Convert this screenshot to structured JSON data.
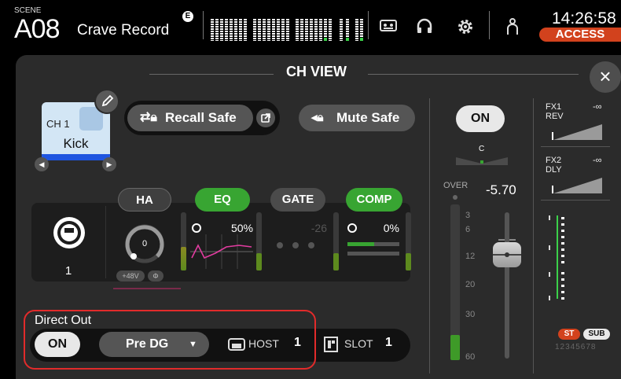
{
  "top": {
    "scene_caption": "SCENE",
    "scene_number": "A08",
    "scene_name": "Crave Record",
    "badge": "E",
    "time": "14:26:58",
    "access": "ACCESS",
    "icons": [
      "tape-recorder-icon",
      "headphones-icon",
      "gear-icon",
      "user-icon"
    ]
  },
  "panel": {
    "title": "CH VIEW",
    "close": "×"
  },
  "channel": {
    "number": "CH 1",
    "name": "Kick",
    "color": "#1f55e0",
    "prev": "◀",
    "next": "▶"
  },
  "safe": {
    "recall_safe": "Recall Safe",
    "mute_safe": "Mute Safe"
  },
  "tabs": {
    "ha": "HA",
    "eq": "EQ",
    "gate": "GATE",
    "comp": "COMP"
  },
  "input": {
    "number": "1"
  },
  "ha": {
    "gain": "0",
    "phantom": "+48V",
    "phase": "Φ"
  },
  "eq": {
    "value": "50%"
  },
  "gate": {
    "value": "-26"
  },
  "comp": {
    "value": "0%"
  },
  "direct_out": {
    "label": "Direct Out",
    "on": "ON",
    "point": "Pre DG",
    "host_label": "HOST",
    "host_value": "1",
    "slot_label": "SLOT",
    "slot_value": "1"
  },
  "fader": {
    "on": "ON",
    "pan": "C",
    "level": "-5.70",
    "over": "OVER",
    "scale": [
      "3",
      "6",
      "12",
      "20",
      "30",
      "60"
    ]
  },
  "sends": {
    "fx1_name": "FX1",
    "fx1_type": "REV",
    "fx1_level": "-∞",
    "fx2_name": "FX2",
    "fx2_type": "DLY",
    "fx2_level": "-∞",
    "st": "ST",
    "sub": "SUB",
    "dca_numbers": "12345678"
  },
  "colors": {
    "green": "#38a532",
    "access": "#d2421d",
    "highlight": "#e22b2b"
  }
}
